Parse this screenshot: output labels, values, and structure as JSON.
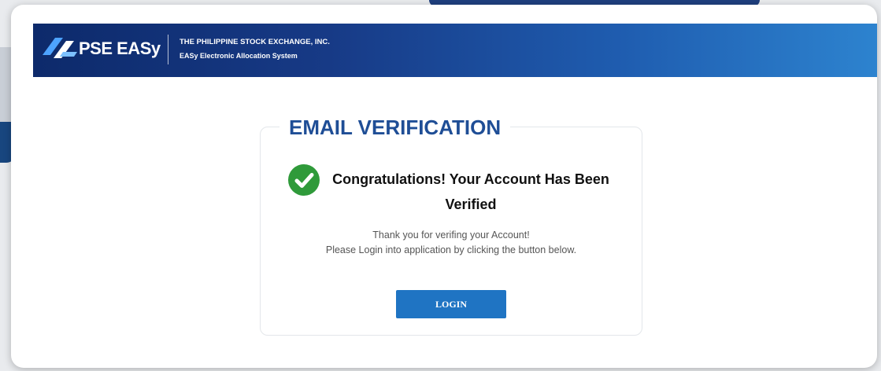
{
  "header": {
    "logo_text": "PSE EASy",
    "org_name": "THE PHILIPPINE STOCK EXCHANGE, INC.",
    "system_name": "EASy Electronic Allocation System"
  },
  "verification": {
    "title": "EMAIL VERIFICATION",
    "status_icon": "check-circle-icon",
    "message": "Congratulations! Your Account Has Been Verified",
    "instructions_line1": "Thank you for verifing your Account!",
    "instructions_line2": "Please Login into application by clicking the button below.",
    "login_label": "LOGIN"
  },
  "colors": {
    "header_start": "#0d2a6b",
    "header_end": "#2d83cf",
    "title": "#1f4e96",
    "success": "#2f9a3a",
    "button": "#1f74c3"
  }
}
